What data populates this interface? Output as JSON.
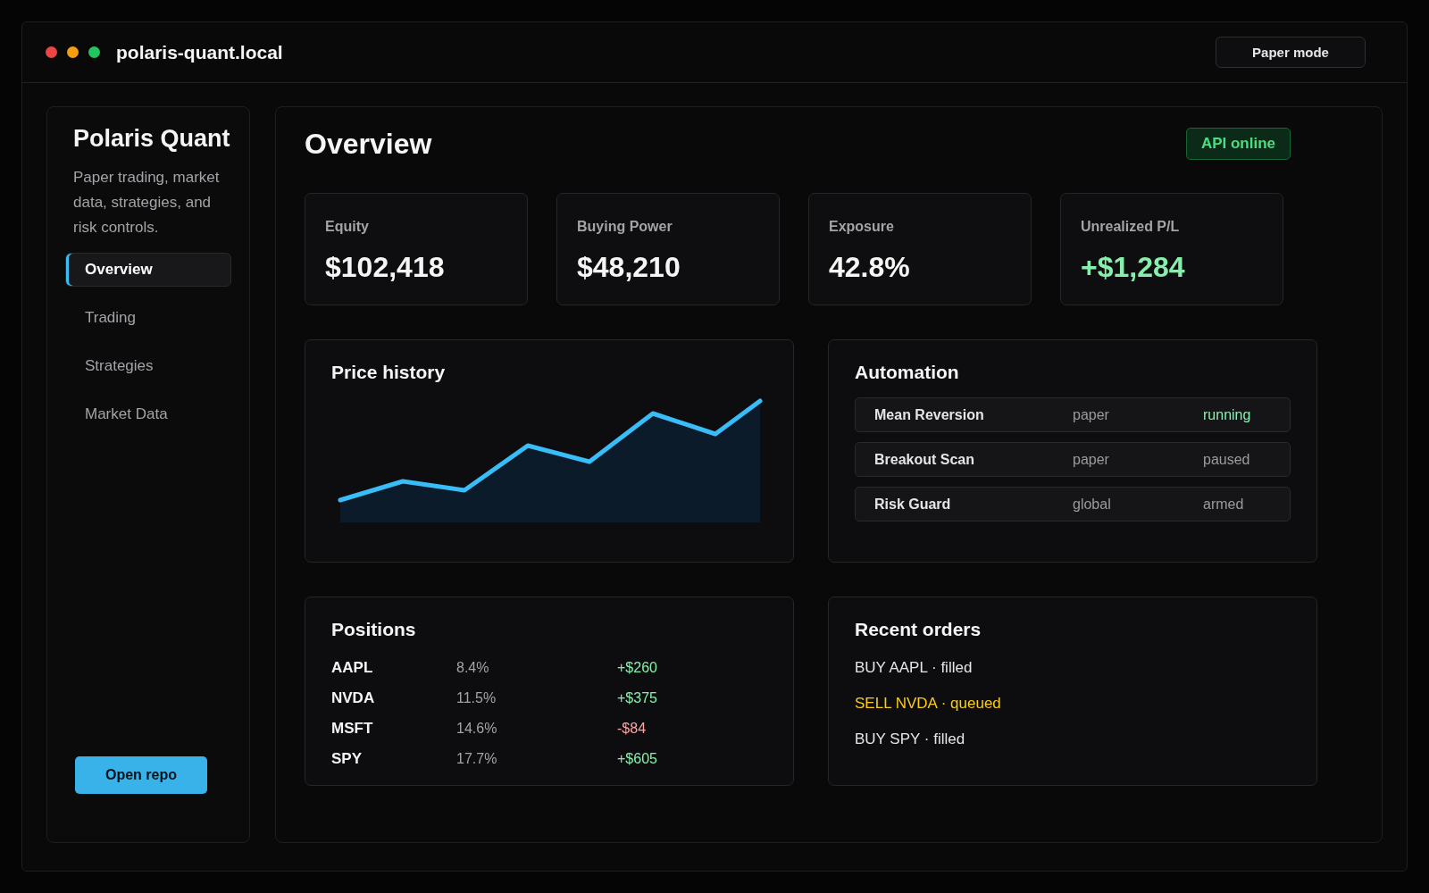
{
  "window": {
    "title": "polaris-quant.local",
    "mode_button": "Paper mode"
  },
  "sidebar": {
    "title": "Polaris Quant",
    "description": "Paper trading, market data, strategies, and risk controls.",
    "items": [
      {
        "label": "Overview",
        "selected": true
      },
      {
        "label": "Trading",
        "selected": false
      },
      {
        "label": "Strategies",
        "selected": false
      },
      {
        "label": "Market Data",
        "selected": false
      }
    ],
    "button": "Open repo"
  },
  "main": {
    "title": "Overview",
    "status_badge": "API online",
    "metrics": [
      {
        "label": "Equity",
        "value": "$102,418",
        "positive": false
      },
      {
        "label": "Buying Power",
        "value": "$48,210",
        "positive": false
      },
      {
        "label": "Exposure",
        "value": "42.8%",
        "positive": false
      },
      {
        "label": "Unrealized P/L",
        "value": "+$1,284",
        "positive": true
      }
    ],
    "price_history": {
      "title": "Price history"
    },
    "automation": {
      "title": "Automation",
      "rows": [
        {
          "name": "Mean Reversion",
          "scope": "paper",
          "status": "running",
          "active": true
        },
        {
          "name": "Breakout Scan",
          "scope": "paper",
          "status": "paused",
          "active": false
        },
        {
          "name": "Risk Guard",
          "scope": "global",
          "status": "armed",
          "active": false
        }
      ]
    },
    "positions": {
      "title": "Positions",
      "rows": [
        {
          "symbol": "AAPL",
          "weight": "8.4%",
          "pl": "+$260",
          "color": "#86efac"
        },
        {
          "symbol": "NVDA",
          "weight": "11.5%",
          "pl": "+$375",
          "color": "#86efac"
        },
        {
          "symbol": "MSFT",
          "weight": "14.6%",
          "pl": "-$84",
          "color": "#fca5a5"
        },
        {
          "symbol": "SPY",
          "weight": "17.7%",
          "pl": "+$605",
          "color": "#86efac"
        }
      ]
    },
    "recent_orders": {
      "title": "Recent orders",
      "items": [
        {
          "text": "BUY AAPL · filled",
          "color": "#e5e5e5"
        },
        {
          "text": "SELL NVDA · queued",
          "color": "#facc15"
        },
        {
          "text": "BUY SPY · filled",
          "color": "#e5e5e5"
        }
      ]
    }
  }
}
